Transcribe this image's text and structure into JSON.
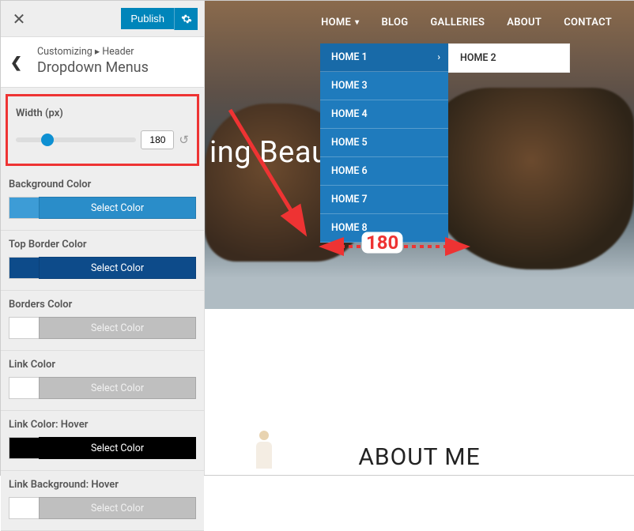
{
  "panel": {
    "publish_label": "Publish",
    "breadcrumb": {
      "root": "Customizing",
      "parent": "Header",
      "title": "Dropdown Menus"
    },
    "width": {
      "label": "Width (px)",
      "value": "180"
    },
    "controls": {
      "bg": {
        "label": "Background Color",
        "button": "Select Color"
      },
      "topborder": {
        "label": "Top Border Color",
        "button": "Select Color"
      },
      "borders": {
        "label": "Borders Color",
        "button": "Select Color"
      },
      "link": {
        "label": "Link Color",
        "button": "Select Color"
      },
      "linkhover": {
        "label": "Link Color: Hover",
        "button": "Select Color"
      },
      "linkbg": {
        "label": "Link Background: Hover",
        "button": "Select Color"
      }
    }
  },
  "preview": {
    "nav": {
      "home": "HOME",
      "blog": "BLOG",
      "galleries": "GALLERIES",
      "about": "ABOUT",
      "contact": "CONTACT"
    },
    "dropdown": {
      "items": [
        "HOME 1",
        "HOME 3",
        "HOME 4",
        "HOME 5",
        "HOME 6",
        "HOME 7",
        "HOME 8"
      ],
      "flyout": "HOME 2"
    },
    "hero_headline_fragment": "ing Beauti              ts.",
    "width_badge": "180",
    "about_title": "ABOUT ME"
  }
}
